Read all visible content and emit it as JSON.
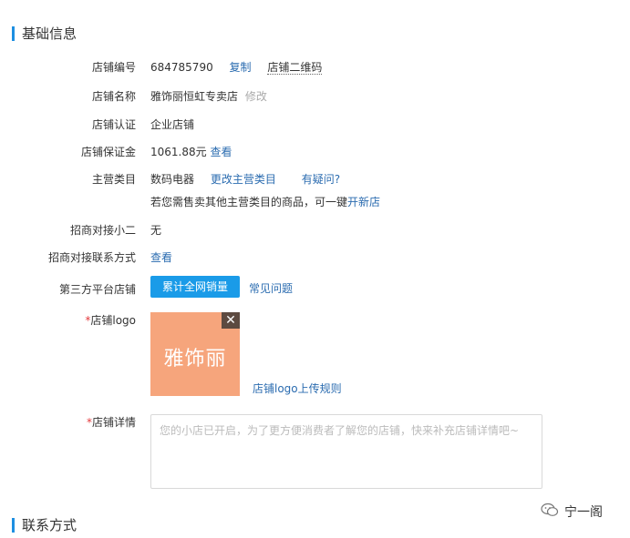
{
  "basic_section": {
    "title": "基础信息"
  },
  "store_id": {
    "label": "店铺编号",
    "value": "684785790",
    "copy_link": "复制",
    "qr_link": "店铺二维码"
  },
  "store_name": {
    "label": "店铺名称",
    "value": "雅饰丽恒虹专卖店",
    "edit_link": "修改"
  },
  "certification": {
    "label": "店铺认证",
    "value": "企业店铺"
  },
  "deposit": {
    "label": "店铺保证金",
    "value": "1061.88元",
    "view_link": "查看"
  },
  "main_category": {
    "label": "主营类目",
    "value": "数码电器",
    "change_link": "更改主营类目",
    "question_link": "有疑问?",
    "hint_text": "若您需售卖其他主营类目的商品，可一键",
    "hint_link": "开新店"
  },
  "merchant_contact": {
    "label": "招商对接小二",
    "value": "无"
  },
  "merchant_contact_method": {
    "label": "招商对接联系方式",
    "view_link": "查看"
  },
  "third_party": {
    "label": "第三方平台店铺",
    "button_label": "累计全网销量",
    "faq_link": "常见问题"
  },
  "store_logo": {
    "required_mark": "*",
    "label": "店铺logo",
    "logo_text": "雅饰丽",
    "rules_link": "店铺logo上传规则",
    "logo_bg_color": "#f6a57c"
  },
  "store_detail": {
    "required_mark": "*",
    "label": "店铺详情",
    "value": "",
    "placeholder": "您的小店已开启，为了更方便消费者了解您的店铺，快来补充店铺详情吧~"
  },
  "contact_section": {
    "title": "联系方式"
  },
  "watermark": {
    "text": "宁一阁",
    "icon": "wechat-icon"
  },
  "colors": {
    "accent": "#1e8fe1",
    "link": "#2b6cb0",
    "required": "#e4393c",
    "button": "#1a9be8"
  }
}
